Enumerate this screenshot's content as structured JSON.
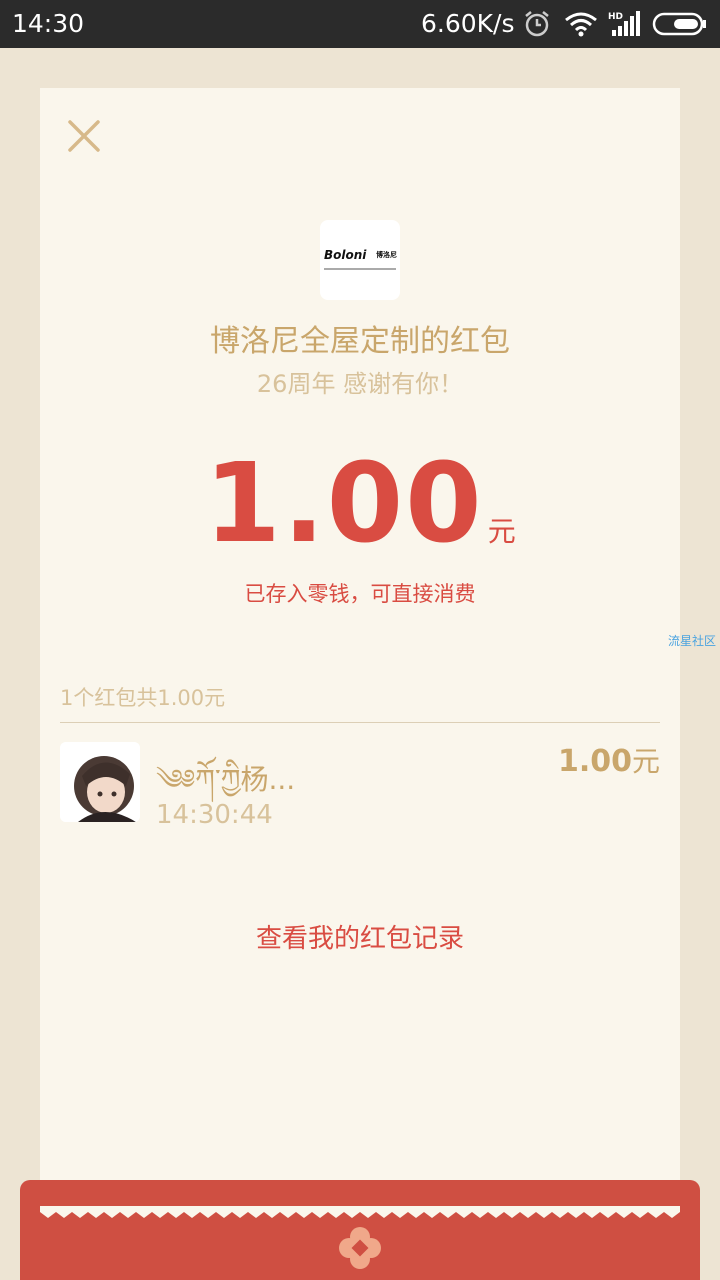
{
  "status_bar": {
    "time": "14:30",
    "net_speed": "6.60K/s",
    "icons": [
      "alarm-icon",
      "wifi-icon",
      "hd-signal-icon",
      "battery-icon"
    ]
  },
  "close_icon": "close-icon",
  "sender": {
    "logo_text": "Boloni",
    "logo_cn": "博洛尼",
    "title": "博洛尼全屋定制的红包",
    "greeting": "26周年 感谢有你！"
  },
  "amount": {
    "value": "1.00",
    "unit": "元",
    "note": "已存入零钱，可直接消费"
  },
  "watermark": "流星社区",
  "summary": "1个红包共1.00元",
  "receivers": [
    {
      "name": "༄༅ཀོ་ཀྱི杨...",
      "time": "14:30:44",
      "amount": "1.00",
      "unit": "元"
    }
  ],
  "records_link": "查看我的红包记录",
  "colors": {
    "accent_red": "#d94c42",
    "gold": "#c9a66b",
    "paper": "#faf6ec",
    "background": "#ede4d3"
  }
}
